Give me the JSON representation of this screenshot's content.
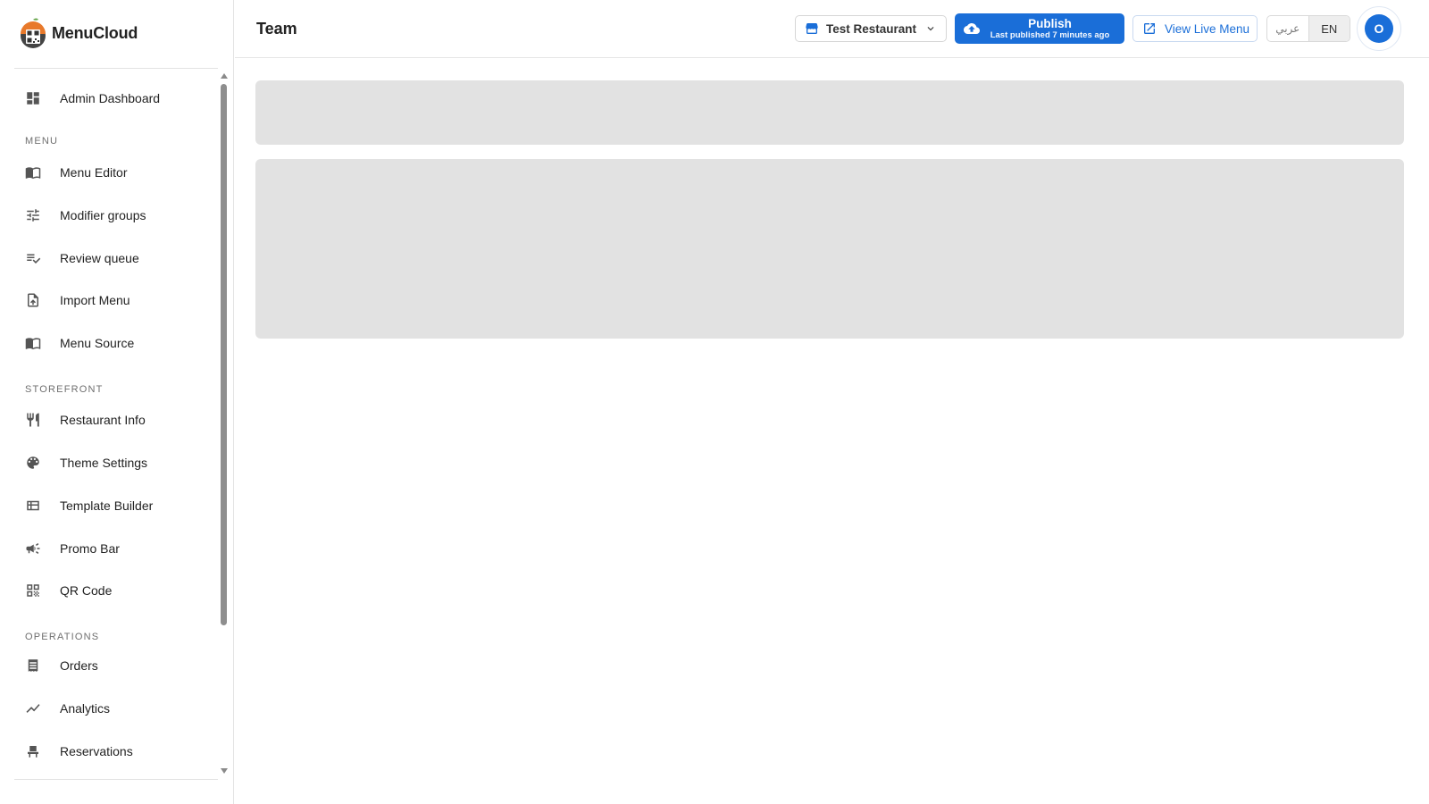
{
  "app": {
    "brand_name": "MenuCloud"
  },
  "header": {
    "page_title": "Team",
    "restaurant_select": {
      "value": "Test Restaurant"
    },
    "publish": {
      "label": "Publish",
      "sublabel": "Last published 7 minutes ago"
    },
    "view_live": {
      "label": "View Live Menu"
    },
    "languages": {
      "arabic": "عربي",
      "english": "EN",
      "active": "EN"
    },
    "avatar": {
      "initial": "O"
    }
  },
  "sidebar": {
    "dashboard": {
      "label": "Admin Dashboard",
      "icon": "dashboard-icon"
    },
    "sections": {
      "menu": {
        "label": "MENU",
        "items": [
          {
            "label": "Menu Editor",
            "icon": "book-icon"
          },
          {
            "label": "Modifier groups",
            "icon": "tune-icon"
          },
          {
            "label": "Review queue",
            "icon": "playlist-check-icon"
          },
          {
            "label": "Import Menu",
            "icon": "file-upload-icon"
          },
          {
            "label": "Menu Source",
            "icon": "book-icon"
          }
        ]
      },
      "storefront": {
        "label": "STOREFRONT",
        "items": [
          {
            "label": "Restaurant Info",
            "icon": "restaurant-icon"
          },
          {
            "label": "Theme Settings",
            "icon": "palette-icon"
          },
          {
            "label": "Template Builder",
            "icon": "template-icon"
          },
          {
            "label": "Promo Bar",
            "icon": "megaphone-icon"
          },
          {
            "label": "QR Code",
            "icon": "qr-code-icon"
          }
        ]
      },
      "operations": {
        "label": "OPERATIONS",
        "items": [
          {
            "label": "Orders",
            "icon": "receipt-icon"
          },
          {
            "label": "Analytics",
            "icon": "analytics-icon"
          },
          {
            "label": "Reservations",
            "icon": "chair-icon"
          }
        ]
      }
    }
  },
  "colors": {
    "primary": "#1a6ed8",
    "skeleton": "#e2e2e2"
  }
}
